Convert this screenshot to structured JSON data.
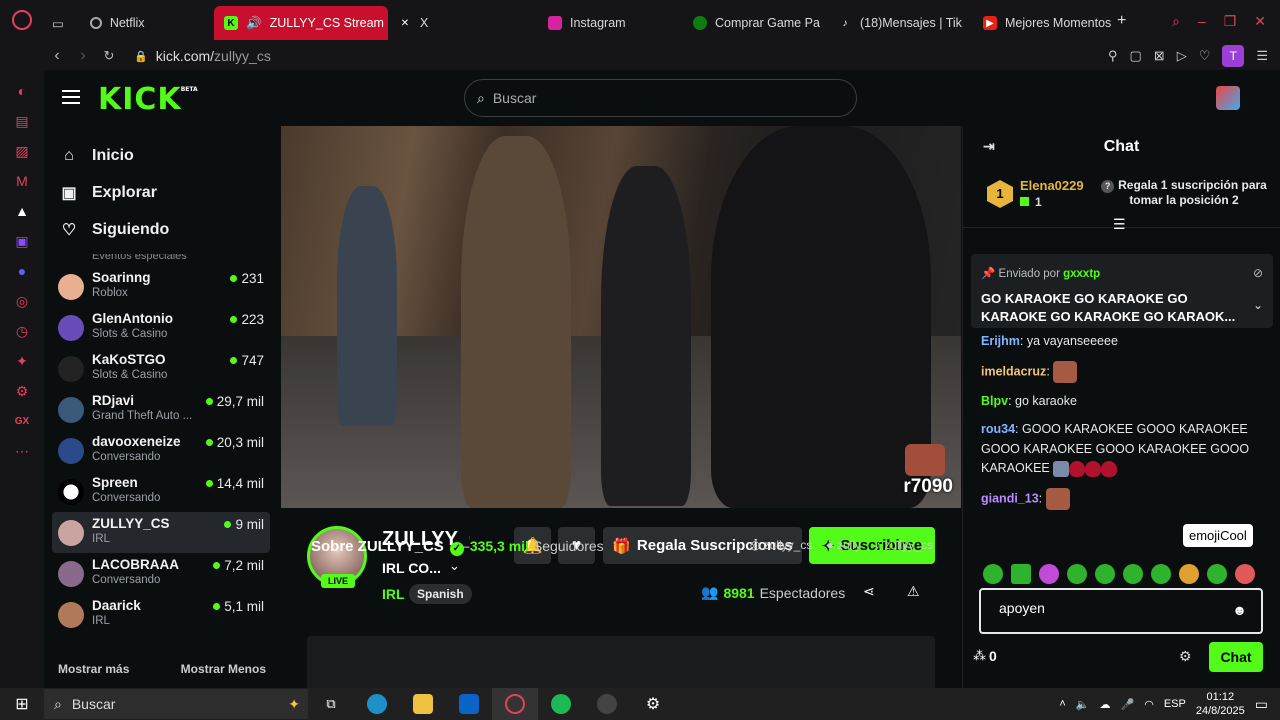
{
  "browser": {
    "tabs": [
      {
        "label": "Netflix",
        "icon": "loading-spinner-icon",
        "active": false
      },
      {
        "label": "ZULLYY_CS Stream -",
        "icon": "kick-logo-icon",
        "active": true
      },
      {
        "label": "X",
        "icon": "x-logo-icon",
        "active": false
      },
      {
        "label": "Instagram",
        "icon": "instagram-icon",
        "active": false
      },
      {
        "label": "Comprar Game Pa",
        "icon": "xbox-icon",
        "active": false
      },
      {
        "label": "(18)Mensajes | Tik",
        "icon": "tiktok-icon",
        "active": false
      },
      {
        "label": "Mejores Momentos",
        "icon": "youtube-icon",
        "active": false
      }
    ],
    "url_domain": "kick.com/",
    "url_path": "zullyy_cs",
    "profile_initial": "T"
  },
  "kick": {
    "search_placeholder": "Buscar",
    "logo_badge": "BETA"
  },
  "sidebar": {
    "nav": [
      {
        "label": "Inicio",
        "icon": "home-icon"
      },
      {
        "label": "Explorar",
        "icon": "browse-icon"
      },
      {
        "label": "Siguiendo",
        "icon": "heart-icon"
      }
    ],
    "section_label": "Eventos especiales",
    "channels": [
      {
        "name": "Soarinng",
        "category": "Roblox",
        "viewers": "231"
      },
      {
        "name": "GlenAntonio",
        "category": "Slots & Casino",
        "viewers": "223"
      },
      {
        "name": "KaKoSTGO",
        "category": "Slots & Casino",
        "viewers": "747"
      },
      {
        "name": "RDjavi",
        "category": "Grand Theft Auto ...",
        "viewers": "29,7 mil"
      },
      {
        "name": "davooxeneize",
        "category": "Conversando",
        "viewers": "20,3 mil"
      },
      {
        "name": "Spreen",
        "category": "Conversando",
        "viewers": "14,4 mil"
      },
      {
        "name": "ZULLYY_CS",
        "category": "IRL",
        "viewers": "9 mil",
        "selected": true
      },
      {
        "name": "LACOBRAAA",
        "category": "Conversando",
        "viewers": "7,2 mil"
      },
      {
        "name": "Daarick",
        "category": "IRL",
        "viewers": "5,1 mil"
      }
    ],
    "show_more": "Mostrar más",
    "show_less": "Mostrar Menos"
  },
  "video": {
    "overlay_text": "r7090"
  },
  "stream": {
    "streamer": "ZULLYY_CS",
    "live_label": "LIVE",
    "title": "IRL CO...",
    "category": "IRL",
    "tag": "Spanish",
    "gift_label": "Regala Suscripciones",
    "subscribe_label": "Suscribirse",
    "viewers_count": "8981",
    "viewers_label": "Espectadores",
    "about_title": "Sobre ZULLYY_CS",
    "followers_count": "335,3 mil",
    "followers_label": "Seguidores",
    "socials": [
      "zullyy_cs",
      "zully",
      "zullyy_cs"
    ]
  },
  "chat": {
    "title": "Chat",
    "leader": {
      "rank": "1",
      "user": "Elena0229",
      "count": "1",
      "cta": "Regala 1 suscripción para tomar la posición 2"
    },
    "pinned": {
      "by_label": "Enviado por",
      "by_user": "gxxxtp",
      "message": "GO KARAOKE GO KARAOKE GO KARAOKE GO KARAOKE GO KARAOK..."
    },
    "messages": [
      {
        "user": "Erijhm",
        "color": "#7fb6ff",
        "text": "ya vayanseeeee"
      },
      {
        "user": "imeldacruz",
        "color": "#f2c27a",
        "text": ""
      },
      {
        "user": "Blpv",
        "color": "#53fc18",
        "text": "go karaoke"
      },
      {
        "user": "rou34",
        "color": "#7fb6ff",
        "text": "GOOO KARAOKEE GOOO KARAOKEE GOOO KARAOKEE GOOO KARAOKEE GOOO KARAOKEE"
      },
      {
        "user": "giandi_13",
        "color": "#b98cff",
        "text": ""
      }
    ],
    "tooltip": "emojiCool",
    "input_value": "apoyen",
    "points": "0",
    "send_label": "Chat"
  },
  "taskbar": {
    "search_placeholder": "Buscar",
    "language": "ESP",
    "time": "01:12",
    "date": "24/8/2025"
  },
  "colors": {
    "accent": "#53fc18",
    "opera_red": "#c8102e"
  }
}
